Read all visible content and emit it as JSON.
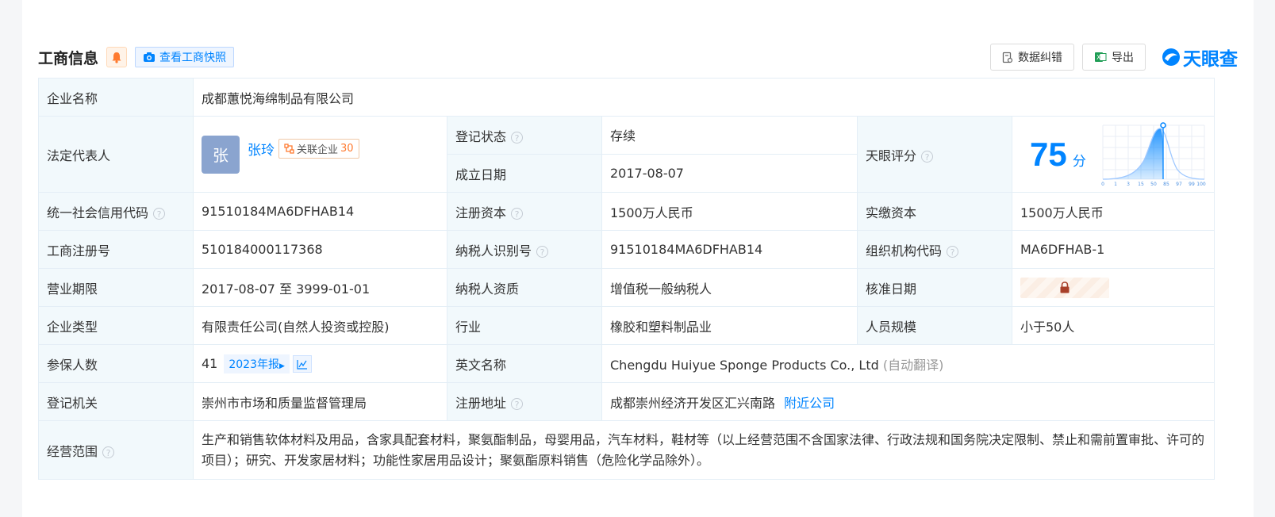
{
  "header": {
    "title": "工商信息",
    "snapshot_label": "查看工商快照",
    "correct_label": "数据纠错",
    "export_label": "导出",
    "brand": "天眼查"
  },
  "rows": {
    "company_name": {
      "label": "企业名称",
      "value": "成都蕙悦海绵制品有限公司"
    },
    "legal_rep": {
      "label": "法定代表人",
      "avatar_char": "张",
      "name": "张玲",
      "related_label": "关联企业",
      "related_count": "30"
    },
    "reg_status": {
      "label": "登记状态",
      "value": "存续"
    },
    "est_date": {
      "label": "成立日期",
      "value": "2017-08-07"
    },
    "tyc_score": {
      "label": "天眼评分",
      "score": "75",
      "unit": "分",
      "axis_ticks": [
        "0",
        "1",
        "3",
        "15",
        "50",
        "85",
        "97",
        "99",
        "100"
      ]
    },
    "credit_code": {
      "label": "统一社会信用代码",
      "value": "91510184MA6DFHAB14"
    },
    "reg_capital": {
      "label": "注册资本",
      "value": "1500万人民币"
    },
    "paid_capital": {
      "label": "实缴资本",
      "value": "1500万人民币"
    },
    "reg_no": {
      "label": "工商注册号",
      "value": "510184000117368"
    },
    "taxpayer_id": {
      "label": "纳税人识别号",
      "value": "91510184MA6DFHAB14"
    },
    "org_code": {
      "label": "组织机构代码",
      "value": "MA6DFHAB-1"
    },
    "term": {
      "label": "营业期限",
      "value": "2017-08-07 至 3999-01-01"
    },
    "taxpayer_qual": {
      "label": "纳税人资质",
      "value": "增值税一般纳税人"
    },
    "approve_date": {
      "label": "核准日期"
    },
    "company_type": {
      "label": "企业类型",
      "value": "有限责任公司(自然人投资或控股)"
    },
    "industry": {
      "label": "行业",
      "value": "橡胶和塑料制品业"
    },
    "staff_size": {
      "label": "人员规模",
      "value": "小于50人"
    },
    "insured": {
      "label": "参保人数",
      "value": "41",
      "year_tag": "2023年报"
    },
    "english_name": {
      "label": "英文名称",
      "value": "Chengdu Huiyue Sponge Products Co., Ltd",
      "auto_note": "(自动翻译)"
    },
    "reg_authority": {
      "label": "登记机关",
      "value": "崇州市市场和质量监督管理局"
    },
    "reg_address": {
      "label": "注册地址",
      "value": "成都崇州经济开发区汇兴南路",
      "nearby_label": "附近公司"
    },
    "scope": {
      "label": "经营范围",
      "value": "生产和销售软体材料及用品，含家具配套材料，聚氨酯制品，母婴用品，汽车材料，鞋材等（以上经营范围不含国家法律、行政法规和国务院决定限制、禁止和需前置审批、许可的项目）；研究、开发家居材料；功能性家居用品设计；聚氨酯原料销售（危险化学品除外）。"
    }
  },
  "colors": {
    "accent": "#0084ff",
    "status_green": "#14b25c",
    "label_bg": "#f2f9fc"
  }
}
